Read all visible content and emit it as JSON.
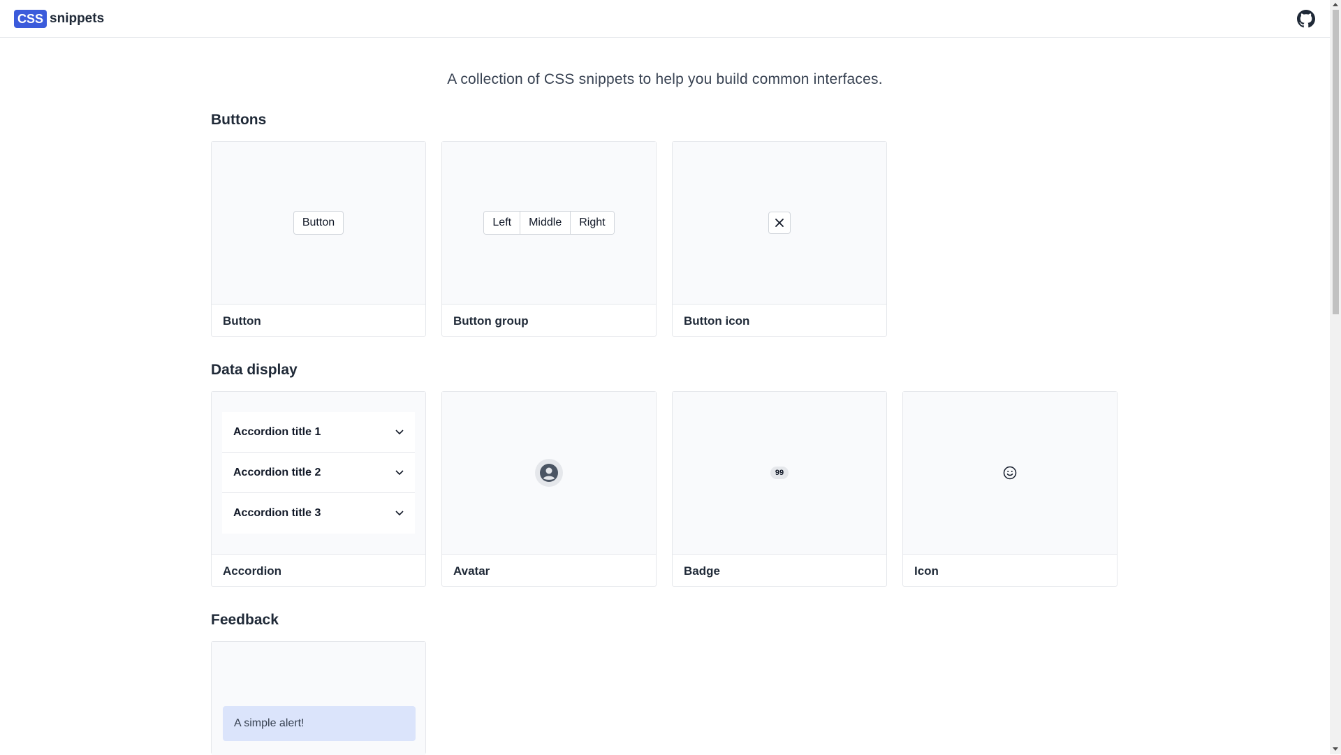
{
  "header": {
    "logo_badge": "CSS",
    "logo_text": "snippets",
    "github_icon": "github-icon"
  },
  "intro": "A collection of CSS snippets to help you build common interfaces.",
  "sections": {
    "buttons": {
      "title": "Buttons",
      "cards": {
        "button": {
          "label": "Button",
          "demo_label": "Button"
        },
        "button_group": {
          "label": "Button group",
          "demo_items": [
            "Left",
            "Middle",
            "Right"
          ]
        },
        "button_icon": {
          "label": "Button icon",
          "icon": "close-icon"
        }
      }
    },
    "data_display": {
      "title": "Data display",
      "cards": {
        "accordion": {
          "label": "Accordion",
          "items": [
            "Accordion title 1",
            "Accordion title 2",
            "Accordion title 3"
          ]
        },
        "avatar": {
          "label": "Avatar",
          "icon": "user-icon"
        },
        "badge": {
          "label": "Badge",
          "value": "99"
        },
        "icon": {
          "label": "Icon",
          "icon": "smiley-icon"
        }
      }
    },
    "feedback": {
      "title": "Feedback",
      "cards": {
        "alert": {
          "alert_text": "A simple alert!"
        }
      }
    }
  },
  "colors": {
    "brand": "#3b5bdb",
    "alert_bg": "#dbe4fb",
    "preview_bg": "#f9fafc",
    "border": "#e5e7eb"
  }
}
